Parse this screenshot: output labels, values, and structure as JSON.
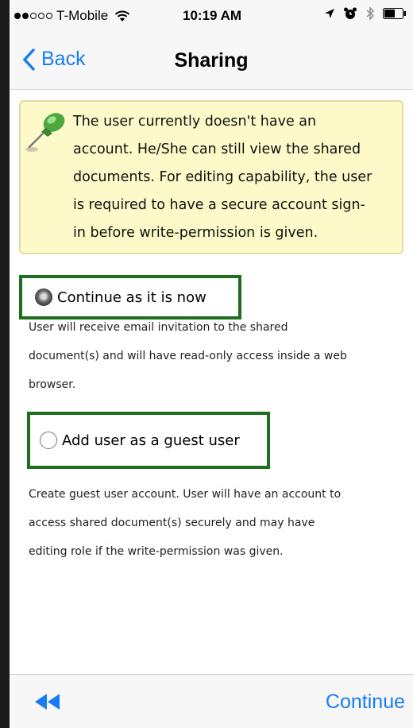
{
  "status_bar": {
    "carrier": "T-Mobile",
    "time": "10:19 AM",
    "signal_dots_filled": 2,
    "signal_dots_total": 5
  },
  "nav": {
    "back_label": "Back",
    "title": "Sharing"
  },
  "notice": {
    "lines": [
      "The user currently doesn't have an",
      "account. He/She can still view the shared",
      "documents. For editing capability, the user",
      "is required to have a secure account sign-",
      "in before write-permission is given."
    ],
    "icon": "pushpin-icon"
  },
  "options": [
    {
      "label": "Continue as it is now",
      "selected": true,
      "description_lines": [
        "User will receive email invitation to the shared",
        "document(s) and will have read-only access inside a web",
        "browser."
      ]
    },
    {
      "label": "Add user as a guest user",
      "selected": false,
      "description_lines": [
        "Create guest user account. User will have an account to",
        "access shared document(s) securely and may have",
        "editing role if the write-permission was given."
      ]
    }
  ],
  "toolbar": {
    "rewind_icon": "rewind-icon",
    "continue_label": "Continue"
  },
  "colors": {
    "accent": "#1a7cf2",
    "highlight_border": "#1f6e1e",
    "notice_bg": "#fdf9c9"
  }
}
